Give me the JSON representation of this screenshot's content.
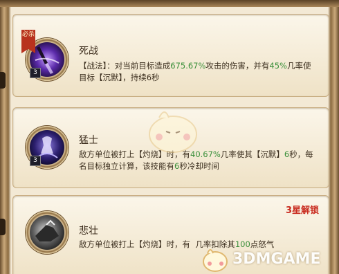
{
  "skills": [
    {
      "name": "死战",
      "level": "3",
      "badge": "必杀",
      "desc_parts": [
        "【战法】：对当前目标造成",
        "675.67%",
        "攻击的伤害，并有",
        "45%",
        "几率使目标【沉默】，持续6秒"
      ]
    },
    {
      "name": "猛士",
      "level": "3",
      "desc_parts": [
        "敌方单位被打上【灼烧】时，有",
        "40.67%",
        "几率使其【沉默】",
        "6",
        "秒，每名目标独立计算，该技能有",
        "6",
        "秒冷却时间"
      ]
    },
    {
      "name": "悲壮",
      "unlock": "3星解锁",
      "desc_parts": [
        "敌方单位被打上【灼烧】时，有",
        "几率扣除其",
        "100",
        "点怒气"
      ]
    }
  ],
  "watermark": "3DMGAME",
  "colors": {
    "highlight": "#3a8f3a",
    "unlock": "#c82a1e",
    "badge": "#b8321e"
  },
  "icons": [
    "sword-slash-icon",
    "warrior-icon",
    "armored-charge-icon"
  ]
}
